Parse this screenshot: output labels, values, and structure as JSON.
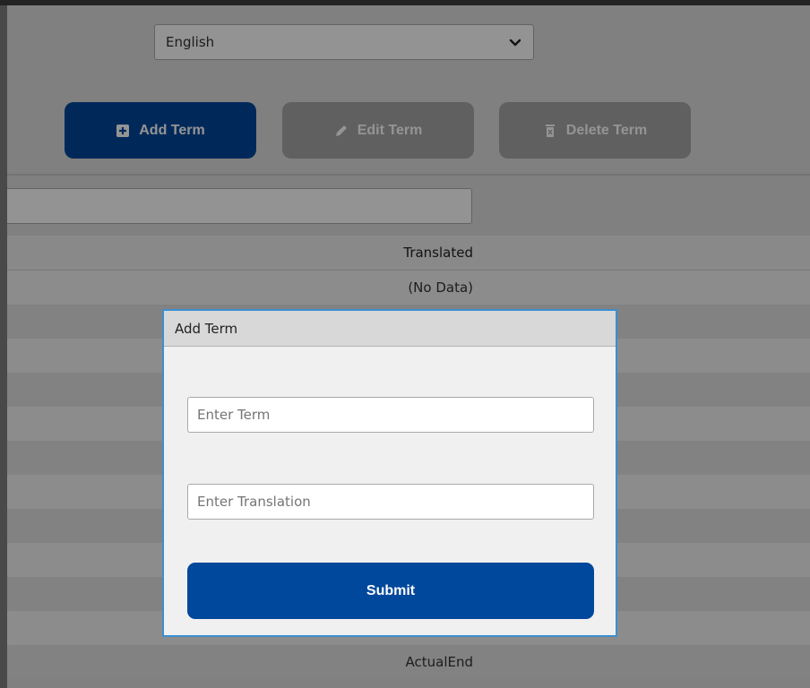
{
  "language_select": {
    "value": "English",
    "icon": "chevron-down-icon"
  },
  "toolbar": {
    "add_label": "Add Term",
    "edit_label": "Edit Term",
    "delete_label": "Delete Term",
    "add_icon": "plus-square-icon",
    "edit_icon": "pencil-icon",
    "delete_icon": "trash-icon"
  },
  "search": {
    "value": ""
  },
  "grid": {
    "column_header": "Translated",
    "empty_text": "(No Data)",
    "footer_text": "ActualEnd"
  },
  "dialog": {
    "title": "Add Term",
    "term_placeholder": "Enter Term",
    "translation_placeholder": "Enter Translation",
    "submit_label": "Submit"
  },
  "colors": {
    "primary": "#00489b",
    "disabled": "#a6a6a6",
    "dialog_border": "#3b8fd0"
  }
}
